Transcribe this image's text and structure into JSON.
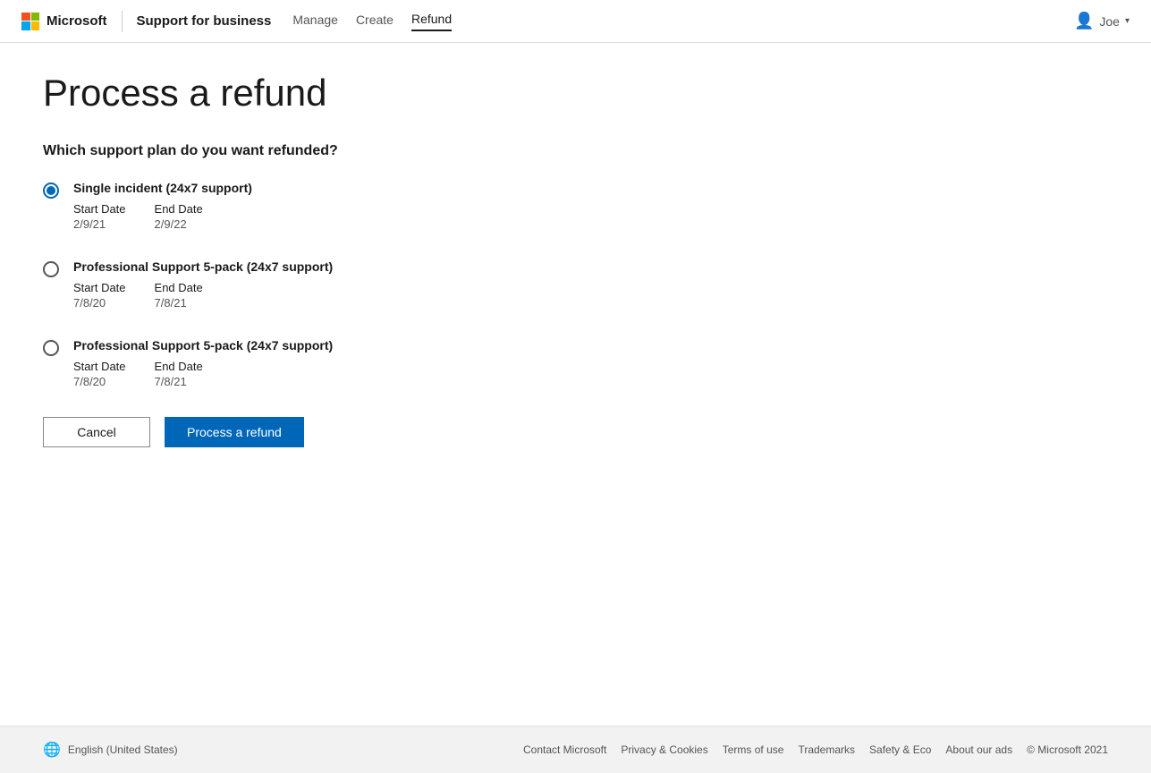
{
  "header": {
    "logo_text": "Microsoft",
    "brand": "Support for business",
    "nav": [
      {
        "label": "Manage",
        "active": false
      },
      {
        "label": "Create",
        "active": false
      },
      {
        "label": "Refund",
        "active": true
      }
    ],
    "user_name": "Joe"
  },
  "page": {
    "title": "Process a refund",
    "section_heading": "Which support plan do you want refunded?",
    "plans": [
      {
        "name": "Single incident (24x7 support)",
        "start_label": "Start Date",
        "start_value": "2/9/21",
        "end_label": "End Date",
        "end_value": "2/9/22",
        "selected": true
      },
      {
        "name": "Professional Support 5-pack (24x7 support)",
        "start_label": "Start Date",
        "start_value": "7/8/20",
        "end_label": "End Date",
        "end_value": "7/8/21",
        "selected": false
      },
      {
        "name": "Professional Support 5-pack (24x7 support)",
        "start_label": "Start Date",
        "start_value": "7/8/20",
        "end_label": "End Date",
        "end_value": "7/8/21",
        "selected": false
      }
    ],
    "cancel_label": "Cancel",
    "submit_label": "Process a refund"
  },
  "footer": {
    "language": "English (United States)",
    "links": [
      "Contact Microsoft",
      "Privacy & Cookies",
      "Terms of use",
      "Trademarks",
      "Safety & Eco",
      "About our ads"
    ],
    "copyright": "© Microsoft 2021"
  }
}
